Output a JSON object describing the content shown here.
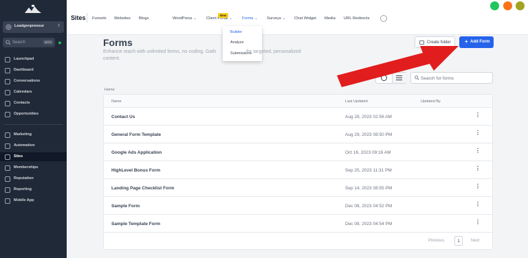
{
  "sidebar": {
    "account_name": "Leadgenpreneur",
    "search_placeholder": "Search",
    "search_kbd": "ctrl K",
    "items_top": [
      {
        "label": "Launchpad"
      },
      {
        "label": "Dashboard"
      },
      {
        "label": "Conversations"
      },
      {
        "label": "Calendars"
      },
      {
        "label": "Contacts"
      },
      {
        "label": "Opportunities"
      }
    ],
    "items_bottom": [
      {
        "label": "Marketing"
      },
      {
        "label": "Automation"
      },
      {
        "label": "Sites",
        "active": true
      },
      {
        "label": "Memberships"
      },
      {
        "label": "Reputation"
      },
      {
        "label": "Reporting"
      },
      {
        "label": "Mobile App"
      }
    ]
  },
  "topbar": {
    "title": "Sites",
    "tabs": [
      {
        "label": "Funnels"
      },
      {
        "label": "Websites"
      },
      {
        "label": "Blogs",
        "badge": "New"
      },
      {
        "label": "WordPress"
      },
      {
        "label": "Client Portal"
      },
      {
        "label": "Forms",
        "active": true
      },
      {
        "label": "Surveys"
      },
      {
        "label": "Chat Widget"
      },
      {
        "label": "Media"
      },
      {
        "label": "URL Redirects"
      }
    ]
  },
  "forms_dropdown": {
    "items": [
      "Builder",
      "Analyze",
      "Submissions"
    ]
  },
  "main": {
    "title": "Forms",
    "description": "Enhance reach with unlimited forms, no coding. Gath… for targeted, personalized content.",
    "desc_line1": "Enhance reach with unlimited forms, no coding. Gath",
    "desc_line1b": "for targeted, personalized",
    "desc_line2": "content.",
    "create_folder_label": "Create folder",
    "add_form_label": "Add Form",
    "search_placeholder": "Search for forms",
    "breadcrumb": "Home",
    "columns": [
      "Name",
      "Last Updated",
      "Updated By"
    ],
    "rows": [
      {
        "name": "Contact Us",
        "updated": "Aug 28, 2023 02:56 AM"
      },
      {
        "name": "General Form Template",
        "updated": "Aug 29, 2023 08:50 PM"
      },
      {
        "name": "Google Ads Application",
        "updated": "Oct 16, 2023 09:16 AM"
      },
      {
        "name": "HighLevel Bonus Form",
        "updated": "Sep 25, 2023 11:31 PM"
      },
      {
        "name": "Landing Page Checklist Form",
        "updated": "Sep 14, 2023 08:55 PM"
      },
      {
        "name": "Sample Form",
        "updated": "Dec 08, 2023 04:52 PM"
      },
      {
        "name": "Sample Template Form",
        "updated": "Dec 08, 2023 04:54 PM"
      }
    ],
    "pager": {
      "previous": "Previous",
      "page": "1",
      "next": "Next"
    }
  },
  "colors": {
    "sidebar_bg": "#1f2937",
    "accent": "#2563eb",
    "arrow": "#e11d1d"
  }
}
